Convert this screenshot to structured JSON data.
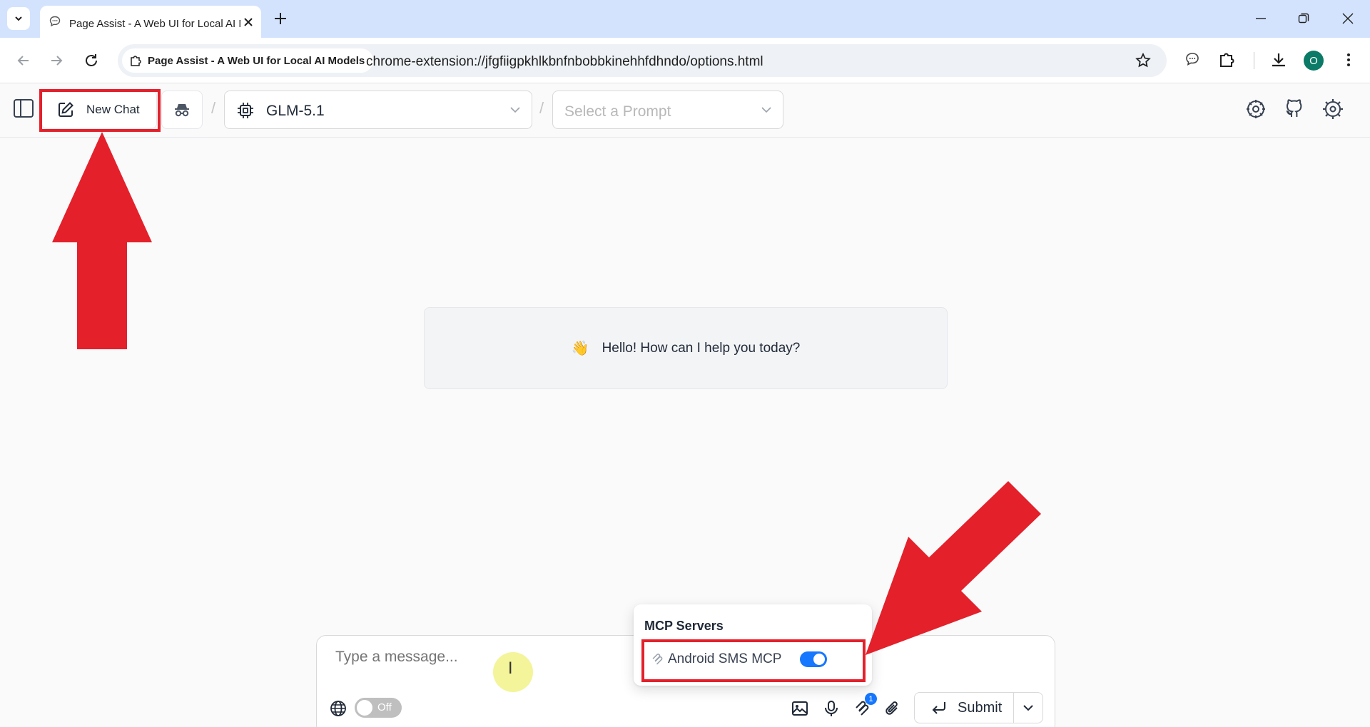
{
  "browser": {
    "tab_title": "Page Assist - A Web UI for Local AI Models",
    "site_chip": "Page Assist - A Web UI for Local AI Models",
    "url": "chrome-extension://jfgfiigpkhlkbnfnbobbkinehhfdhndo/options.html",
    "profile_initial": "O"
  },
  "header": {
    "new_chat_label": "New Chat",
    "separator": "/",
    "model_name": "GLM-5.1",
    "prompt_placeholder": "Select a Prompt"
  },
  "main": {
    "greeting_emoji": "👋",
    "greeting_text": "Hello! How can I help you today?"
  },
  "composer": {
    "placeholder": "Type a message...",
    "web_search_toggle": "Off",
    "mcp_badge_count": "1",
    "submit_label": "Submit"
  },
  "mcp_popover": {
    "title": "MCP Servers",
    "servers": [
      {
        "name": "Android SMS MCP",
        "enabled": true
      }
    ]
  },
  "colors": {
    "annotation_red": "#e4202b",
    "accent_blue": "#1677ff",
    "tabbar_blue": "#d3e3fd"
  }
}
